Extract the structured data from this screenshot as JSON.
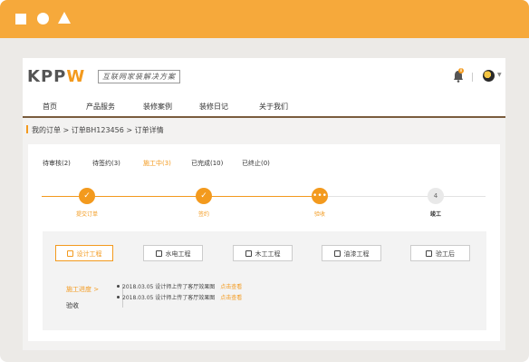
{
  "brand": {
    "logo_main": "KPP",
    "logo_accent": "W",
    "slogan": "互联网家装解决方案"
  },
  "header": {
    "notification_count": "8"
  },
  "nav": {
    "items": [
      "首页",
      "产品服务",
      "装修案例",
      "装修日记",
      "关于我们"
    ]
  },
  "breadcrumb": {
    "text": "我的订单 > 订单BH123456 > 订单详情"
  },
  "tabs": [
    {
      "label": "待审核(2)"
    },
    {
      "label": "待签约(3)"
    },
    {
      "label": "施工中(3)"
    },
    {
      "label": "已完成(10)"
    },
    {
      "label": "已终止(0)"
    }
  ],
  "active_tab_index": 2,
  "steps": [
    {
      "label": "提交订单",
      "state": "done",
      "icon": "check-icon"
    },
    {
      "label": "签约",
      "state": "done",
      "icon": "check-icon"
    },
    {
      "label": "验收",
      "state": "current",
      "icon": "more-icon"
    },
    {
      "label": "竣工",
      "state": "todo",
      "number": "4"
    }
  ],
  "work_items": [
    {
      "label": "设计工程",
      "icon": "design-icon",
      "active": true
    },
    {
      "label": "水电工程",
      "icon": "worker-icon",
      "active": false
    },
    {
      "label": "木工工程",
      "icon": "wood-icon",
      "active": false
    },
    {
      "label": "油漆工程",
      "icon": "paint-icon",
      "active": false
    },
    {
      "label": "验工后",
      "icon": "check-box-icon",
      "active": false
    }
  ],
  "progress_side": {
    "current": "施工进度 >",
    "other": "验收"
  },
  "logs": [
    {
      "text": "2018.03.05  设计师上传了客厅效果图",
      "link": "点击查看"
    },
    {
      "text": "2018.03.05  设计师上传了客厅效果图",
      "link": "点击查看"
    }
  ],
  "colors": {
    "accent": "#f39a1e",
    "topbar": "#f6a93b",
    "nav_border": "#7a5c3d"
  }
}
